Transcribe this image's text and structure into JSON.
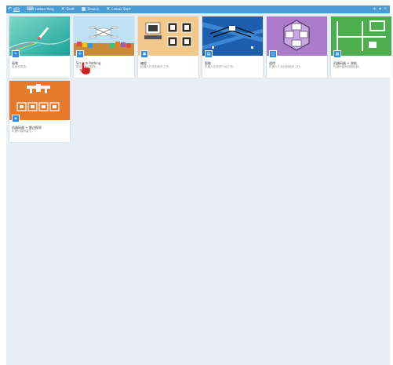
{
  "topbar": {
    "items": [
      {
        "icon": "back-arrow-icon",
        "glyph": "↶",
        "label": "返回"
      },
      {
        "icon": "code-icon",
        "glyph": "⌨",
        "label": "Liebao Yang"
      },
      {
        "icon": "tools-icon",
        "glyph": "✕",
        "label": "Draft"
      },
      {
        "icon": "grid-icon",
        "glyph": "▦",
        "label": "Draw.io"
      },
      {
        "icon": "tools-icon",
        "glyph": "✕",
        "label": "Liebao Start"
      }
    ]
  },
  "cards": [
    {
      "title": "画笔",
      "desc": "绘画和笔迹。",
      "badge": "✎"
    },
    {
      "title": "Scratch Pathing",
      "desc": "路径和运动程序。",
      "badge": "✢"
    },
    {
      "title": "编程",
      "desc": "机器人行走的程序工作。",
      "badge": "▣"
    },
    {
      "title": "智能",
      "desc": "机器人在前进行动工作。",
      "badge": "▤"
    },
    {
      "title": "遥控",
      "desc": "机器人平台控制程序工作。",
      "badge": "◫"
    },
    {
      "title": "机器码器 + 测绘",
      "desc": "机器码器和地图绘制。",
      "badge": "▦"
    },
    {
      "title": "机器码器 + 雷达探测",
      "desc": "机器码器和雷达。",
      "badge": "◈"
    }
  ],
  "colors": {
    "topbar": "#4a9cd6",
    "content_bg": "#e8eef6",
    "badge": "#2d8ce6"
  }
}
